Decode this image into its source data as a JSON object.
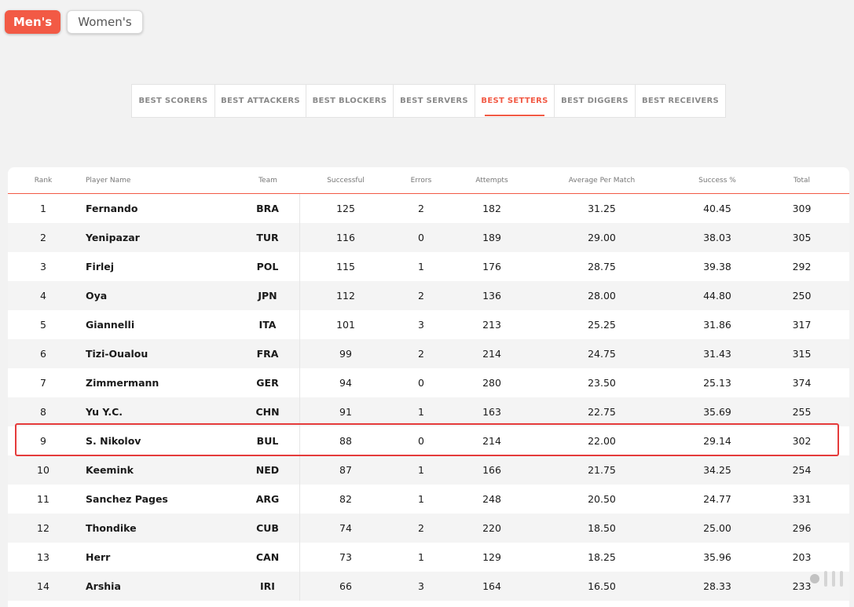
{
  "gender_tabs": {
    "men": "Men's",
    "women": "Women's",
    "active": "men"
  },
  "category_tabs": [
    {
      "label": "BEST SCORERS",
      "active": false
    },
    {
      "label": "BEST ATTACKERS",
      "active": false
    },
    {
      "label": "BEST BLOCKERS",
      "active": false
    },
    {
      "label": "BEST SERVERS",
      "active": false
    },
    {
      "label": "BEST SETTERS",
      "active": true
    },
    {
      "label": "BEST DIGGERS",
      "active": false
    },
    {
      "label": "BEST RECEIVERS",
      "active": false
    }
  ],
  "table": {
    "headers": {
      "rank": "Rank",
      "player": "Player Name",
      "team": "Team",
      "successful": "Successful",
      "errors": "Errors",
      "attempts": "Attempts",
      "avg": "Average Per Match",
      "success_pct": "Success %",
      "total": "Total"
    },
    "rows": [
      {
        "rank": "1",
        "player": "Fernando",
        "team": "BRA",
        "successful": "125",
        "errors": "2",
        "attempts": "182",
        "avg": "31.25",
        "pct": "40.45",
        "total": "309"
      },
      {
        "rank": "2",
        "player": "Yenipazar",
        "team": "TUR",
        "successful": "116",
        "errors": "0",
        "attempts": "189",
        "avg": "29.00",
        "pct": "38.03",
        "total": "305"
      },
      {
        "rank": "3",
        "player": "Firlej",
        "team": "POL",
        "successful": "115",
        "errors": "1",
        "attempts": "176",
        "avg": "28.75",
        "pct": "39.38",
        "total": "292"
      },
      {
        "rank": "4",
        "player": "Oya",
        "team": "JPN",
        "successful": "112",
        "errors": "2",
        "attempts": "136",
        "avg": "28.00",
        "pct": "44.80",
        "total": "250"
      },
      {
        "rank": "5",
        "player": "Giannelli",
        "team": "ITA",
        "successful": "101",
        "errors": "3",
        "attempts": "213",
        "avg": "25.25",
        "pct": "31.86",
        "total": "317"
      },
      {
        "rank": "6",
        "player": "Tizi-Oualou",
        "team": "FRA",
        "successful": "99",
        "errors": "2",
        "attempts": "214",
        "avg": "24.75",
        "pct": "31.43",
        "total": "315"
      },
      {
        "rank": "7",
        "player": "Zimmermann",
        "team": "GER",
        "successful": "94",
        "errors": "0",
        "attempts": "280",
        "avg": "23.50",
        "pct": "25.13",
        "total": "374"
      },
      {
        "rank": "8",
        "player": "Yu Y.C.",
        "team": "CHN",
        "successful": "91",
        "errors": "1",
        "attempts": "163",
        "avg": "22.75",
        "pct": "35.69",
        "total": "255"
      },
      {
        "rank": "9",
        "player": "S. Nikolov",
        "team": "BUL",
        "successful": "88",
        "errors": "0",
        "attempts": "214",
        "avg": "22.00",
        "pct": "29.14",
        "total": "302",
        "highlighted": true
      },
      {
        "rank": "10",
        "player": "Keemink",
        "team": "NED",
        "successful": "87",
        "errors": "1",
        "attempts": "166",
        "avg": "21.75",
        "pct": "34.25",
        "total": "254"
      },
      {
        "rank": "11",
        "player": "Sanchez Pages",
        "team": "ARG",
        "successful": "82",
        "errors": "1",
        "attempts": "248",
        "avg": "20.50",
        "pct": "24.77",
        "total": "331"
      },
      {
        "rank": "12",
        "player": "Thondike",
        "team": "CUB",
        "successful": "74",
        "errors": "2",
        "attempts": "220",
        "avg": "18.50",
        "pct": "25.00",
        "total": "296"
      },
      {
        "rank": "13",
        "player": "Herr",
        "team": "CAN",
        "successful": "73",
        "errors": "1",
        "attempts": "129",
        "avg": "18.25",
        "pct": "35.96",
        "total": "203"
      },
      {
        "rank": "14",
        "player": "Arshia",
        "team": "IRI",
        "successful": "66",
        "errors": "3",
        "attempts": "164",
        "avg": "16.50",
        "pct": "28.33",
        "total": "233"
      }
    ]
  },
  "colors": {
    "accent": "#f25a45",
    "highlight_border": "#e53b3b"
  }
}
